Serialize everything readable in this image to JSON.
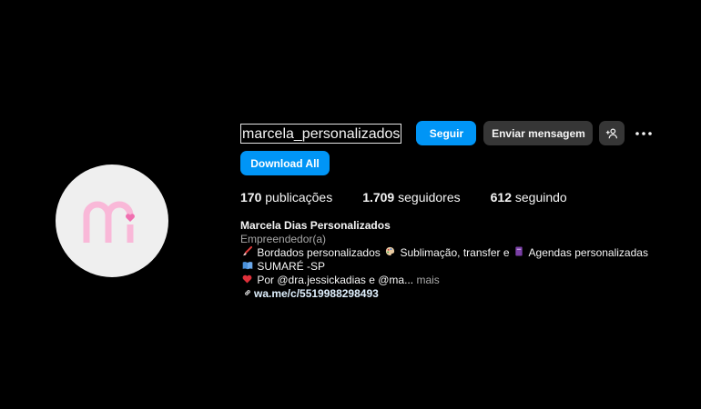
{
  "profile": {
    "username": "marcela_personalizados",
    "avatar_initial": "mi",
    "follow_label": "Seguir",
    "message_label": "Enviar mensagem",
    "download_label": "Download All"
  },
  "stats": {
    "posts_count": "170",
    "posts_label": "publicações",
    "followers_count": "1.709",
    "followers_label": "seguidores",
    "following_count": "612",
    "following_label": "seguindo"
  },
  "bio": {
    "name": "Marcela Dias Personalizados",
    "category": "Empreendedor(a)",
    "line1_a": "Bordados personalizados",
    "line1_b": "Sublimação, transfer e",
    "line1_c": "Agendas personalizadas",
    "line2": "SUMARÉ -SP",
    "line3": "Por @dra.jessickadias e @ma...",
    "more_label": "mais",
    "link": "wa.me/c/5519988298493"
  },
  "icons": {
    "add_person": "add-person-icon",
    "more": "more-options-icon",
    "link": "link-icon"
  },
  "colors": {
    "background": "#000000",
    "primary_button": "#0095f6",
    "secondary_button": "#363636",
    "avatar_bg": "#efefef",
    "avatar_logo": "#f9b8d8"
  }
}
